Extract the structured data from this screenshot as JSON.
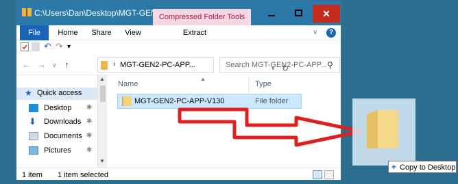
{
  "window": {
    "title": "C:\\Users\\Dan\\Desktop\\MGT-GEN2-...",
    "contextual_tab": "Compressed Folder Tools"
  },
  "ribbon": {
    "tabs": [
      "File",
      "Home",
      "Share",
      "View",
      "Extract"
    ]
  },
  "address": {
    "path": "MGT-GEN2-PC-APP...",
    "search_placeholder": "Search MGT-GEN2-PC-APP..."
  },
  "nav_pane": {
    "items": [
      {
        "label": "Quick access",
        "icon": "star-icon"
      },
      {
        "label": "Desktop",
        "icon": "desktop-icon"
      },
      {
        "label": "Downloads",
        "icon": "download-icon"
      },
      {
        "label": "Documents",
        "icon": "documents-icon"
      },
      {
        "label": "Pictures",
        "icon": "pictures-icon"
      }
    ]
  },
  "file_list": {
    "columns": [
      "Name",
      "Type"
    ],
    "rows": [
      {
        "name": "MGT-GEN2-PC-APP-V130",
        "type": "File folder"
      }
    ]
  },
  "status": {
    "count": "1 item",
    "selection": "1 item selected"
  },
  "drag": {
    "tooltip": "Copy to Desktop"
  },
  "colors": {
    "desktop_bg": "#2b6e8f",
    "titlebar": "#2b79a8",
    "file_tab": "#1a64b8",
    "close_button": "#c42b1c",
    "arrow": "#e02020"
  }
}
